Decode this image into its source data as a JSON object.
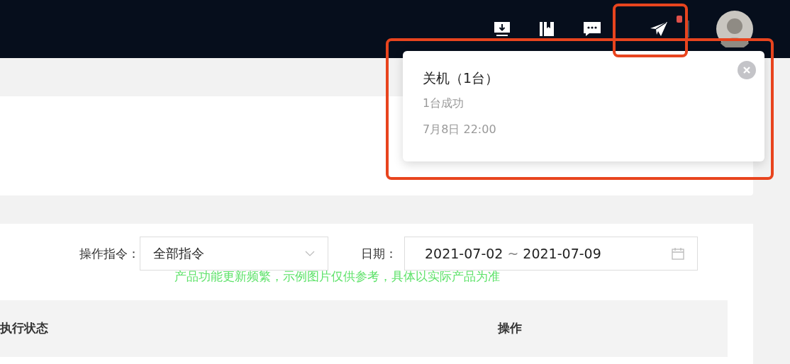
{
  "header": {
    "send_badge": true
  },
  "notification": {
    "title": "关机（1台）",
    "detail": "1台成功",
    "time": "7月8日 22:00"
  },
  "filters": [
    {
      "kind": "select",
      "label": "操作指令：",
      "value": "全部指令"
    },
    {
      "kind": "daterange",
      "label": "日期：",
      "start": "2021-07-02",
      "separator": "~",
      "end": "2021-07-09"
    }
  ],
  "note": "产品功能更新频繁，示例图片仅供参考，具体以实际产品为准",
  "table": {
    "columns": [
      "执行状态",
      "操作"
    ]
  }
}
